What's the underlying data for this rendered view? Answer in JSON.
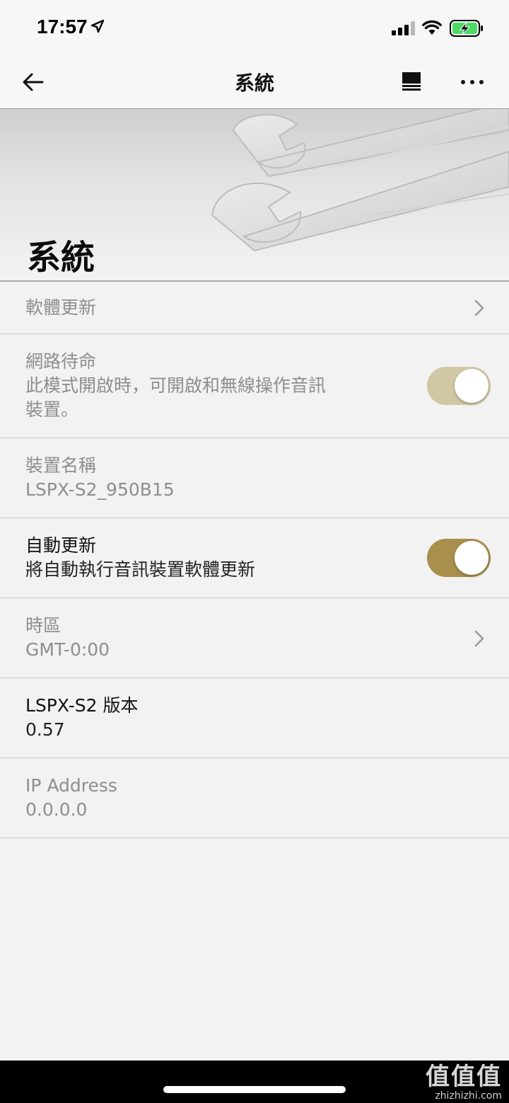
{
  "status_bar": {
    "time": "17:57",
    "icons": [
      "location-arrow-icon",
      "signal-icon",
      "wifi-icon",
      "battery-charging-icon"
    ]
  },
  "nav": {
    "title": "系統",
    "icons": [
      "back-arrow-icon",
      "playback-queue-icon",
      "more-icon"
    ]
  },
  "banner": {
    "title": "系統"
  },
  "settings": {
    "software_update": {
      "title": "軟體更新"
    },
    "network_standby": {
      "title": "網路待命",
      "desc_line1": "此模式開啟時，可開啟和無線操作音訊",
      "desc_line2": "裝置。",
      "enabled": true
    },
    "device_name": {
      "title": "裝置名稱",
      "value": "LSPX-S2_950B15"
    },
    "auto_update": {
      "title": "自動更新",
      "desc": "將自動執行音訊裝置軟體更新",
      "enabled": true
    },
    "timezone": {
      "title": "時區",
      "value": "GMT-0:00"
    },
    "version": {
      "title": "LSPX-S2 版本",
      "value": "0.57"
    },
    "ip_address": {
      "title": "IP Address",
      "value": "0.0.0.0"
    }
  },
  "colors": {
    "toggle_active": "#a88f4c",
    "toggle_dimmed": "#d2c7a4",
    "text_dim": "#8e8e8e"
  },
  "watermark": {
    "logo": "值值值",
    "url": "zhizhizhi.com"
  }
}
